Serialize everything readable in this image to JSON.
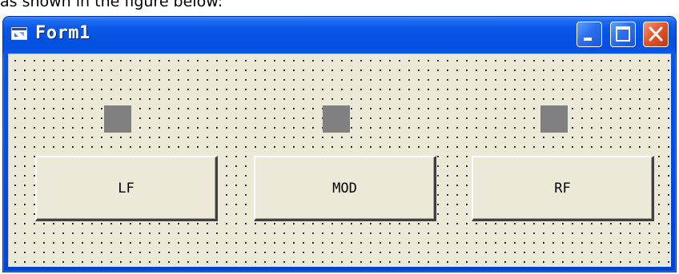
{
  "caption": "as shown in the figure below:",
  "window": {
    "title": "Form1",
    "controls": {
      "minimize": "minimize-icon",
      "maximize": "maximize-icon",
      "close": "close-icon"
    }
  },
  "indicators": [
    {
      "name": "lf-indicator",
      "color": "#808080"
    },
    {
      "name": "mod-indicator",
      "color": "#808080"
    },
    {
      "name": "rf-indicator",
      "color": "#808080"
    }
  ],
  "buttons": [
    {
      "label": "LF"
    },
    {
      "label": "MOD"
    },
    {
      "label": "RF"
    }
  ],
  "colors": {
    "titlebar": "#0552e0",
    "client": "#ece9d8",
    "close_button": "#e3572b",
    "indicator": "#808080"
  }
}
